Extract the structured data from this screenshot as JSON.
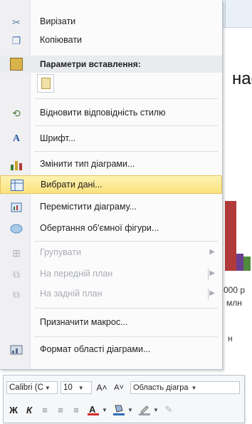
{
  "background": {
    "title_fragment": "нас",
    "label_a": "000 р",
    "label_b": "млн",
    "label_c": "н",
    "bar_colors": [
      "#b03a3a",
      "#6b3f8f",
      "#4f8a3c"
    ]
  },
  "menu": {
    "items": [
      {
        "label": "Вирізати",
        "icon": "scissors-icon",
        "glyph": "✂",
        "color": "#5a7fb3"
      },
      {
        "label": "Копіювати",
        "icon": "copy-icon",
        "glyph": "❐",
        "color": "#4f7db8"
      },
      {
        "label": "Параметри вставлення:",
        "icon": "paste-icon",
        "glyph": "📋",
        "color": "#6b8e3c"
      },
      {
        "label": "Відновити відповідність стилю",
        "icon": "reset-style-icon",
        "glyph": "⟲",
        "color": "#4c7a3a"
      },
      {
        "label": "Шрифт...",
        "icon": "font-icon",
        "glyph": "A",
        "color": "#2a5aa8"
      },
      {
        "label": "Змінити тип діаграми...",
        "icon": "change-chart-type-icon",
        "glyph": "▮",
        "color": "#3d7d3a"
      },
      {
        "label": "Вибрати дані...",
        "icon": "select-data-icon",
        "glyph": "▦",
        "color": "#3f6fae"
      },
      {
        "label": "Перемістити діаграму...",
        "icon": "move-chart-icon",
        "glyph": "⤧",
        "color": "#3f6fae"
      },
      {
        "label": "Обертання об'ємної фігури...",
        "icon": "3d-rotation-icon",
        "glyph": "◐",
        "color": "#4c8fc8"
      },
      {
        "label": "Групувати",
        "icon": "group-icon",
        "glyph": "⊞",
        "color": "#b0b4ba"
      },
      {
        "label": "На передній план",
        "icon": "bring-front-icon",
        "glyph": "⧉",
        "color": "#b0b4ba"
      },
      {
        "label": "На задній план",
        "icon": "send-back-icon",
        "glyph": "⧉",
        "color": "#b0b4ba"
      },
      {
        "label": "Призначити макрос...",
        "icon": "",
        "glyph": "",
        "color": ""
      },
      {
        "label": "Формат області діаграми...",
        "icon": "format-chart-area-icon",
        "glyph": "▤",
        "color": "#5a6e8c"
      }
    ],
    "paste_option_icon": "paste-option-icon",
    "submenu_arrow": "▶"
  },
  "mini_toolbar": {
    "font_name": "Calibri (C",
    "font_size": "10",
    "grow_font": "A˄",
    "shrink_font": "A˅",
    "area_select": "Область діагра",
    "bold": "Ж",
    "italic": "К",
    "font_color_accent": "#d22b2b",
    "fill_color_accent": "#2f6db5"
  }
}
